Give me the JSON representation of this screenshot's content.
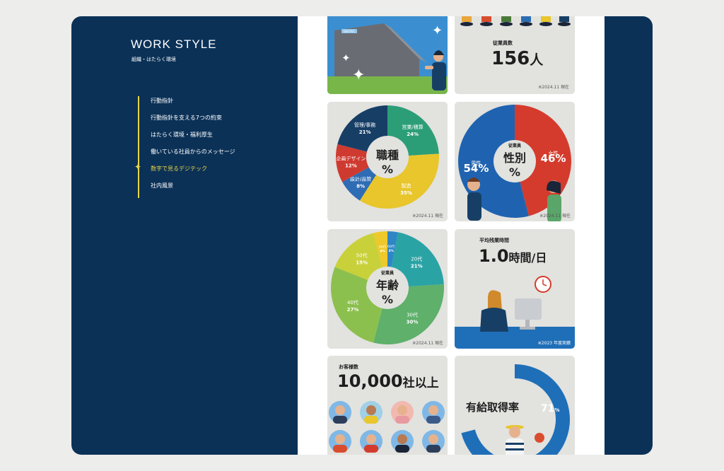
{
  "sidebar": {
    "title": "WORK STYLE",
    "subtitle": "組織・はたらく環境",
    "items": [
      {
        "label": "行動指針",
        "active": false
      },
      {
        "label": "行動指針を支える7つの約束",
        "active": false
      },
      {
        "label": "はたらく環境・福利厚生",
        "active": false
      },
      {
        "label": "働いている社員からのメッセージ",
        "active": false
      },
      {
        "label": "数字で見るデジテック",
        "active": true
      },
      {
        "label": "社内風景",
        "active": false
      }
    ]
  },
  "employees": {
    "label": "従業員数",
    "value": "156",
    "unit": "人",
    "note": "※2024.11 現在"
  },
  "building": {
    "sign": "DIGITEC"
  },
  "job_chart": {
    "center_line1": "職種",
    "center_line2": "%",
    "note": "※2024.11 現在",
    "slices": [
      {
        "name": "営業/積算",
        "value": 24,
        "pct": "24%",
        "color": "#2c9e77"
      },
      {
        "name": "製造",
        "value": 35,
        "pct": "35%",
        "color": "#e8c62c"
      },
      {
        "name": "設計/品管",
        "value": 8,
        "pct": "8%",
        "color": "#2e6cb4"
      },
      {
        "name": "企画デザイン",
        "value": 12,
        "pct": "12%",
        "color": "#cf3a30"
      },
      {
        "name": "管理/事務",
        "value": 21,
        "pct": "21%",
        "color": "#173f66"
      }
    ]
  },
  "gender_chart": {
    "center_small": "従業員",
    "center_line1": "性別",
    "center_line2": "%",
    "note": "※2024.11 現在",
    "slices": [
      {
        "name": "女性",
        "value": 46,
        "pct": "46%",
        "color": "#d43b2c"
      },
      {
        "name": "男性",
        "value": 54,
        "pct": "54%",
        "color": "#1f63b0"
      }
    ]
  },
  "age_chart": {
    "center_small": "従業員",
    "center_line1": "年齢",
    "center_line2": "%",
    "note": "※2024.11 現在",
    "slices": [
      {
        "name": "60代",
        "value": 3,
        "pct": "3%",
        "color": "#2f86c5"
      },
      {
        "name": "20代",
        "value": 21,
        "pct": "21%",
        "color": "#2aa3a5"
      },
      {
        "name": "30代",
        "value": 30,
        "pct": "30%",
        "color": "#5eb06a"
      },
      {
        "name": "40代",
        "value": 27,
        "pct": "27%",
        "color": "#8cc04e"
      },
      {
        "name": "50代",
        "value": 15,
        "pct": "15%",
        "color": "#c8d13a"
      },
      {
        "name": "60代",
        "value": 4,
        "pct": "4%",
        "color": "#eec92b"
      }
    ]
  },
  "overtime": {
    "label": "平均残業時間",
    "value": "1.0",
    "unit": "時間/日",
    "note": "※2023 年度実績"
  },
  "clients": {
    "label": "お客様数",
    "value": "10,000",
    "unit": "社以上"
  },
  "leave": {
    "label": "有給取得率",
    "value": "71",
    "unit": "%",
    "rate": 71
  },
  "chart_data": [
    {
      "type": "pie",
      "title": "職種",
      "categories": [
        "営業/積算",
        "製造",
        "設計/品管",
        "企画デザイン",
        "管理/事務"
      ],
      "values": [
        24,
        35,
        8,
        12,
        21
      ]
    },
    {
      "type": "pie",
      "title": "性別",
      "categories": [
        "女性",
        "男性"
      ],
      "values": [
        46,
        54
      ]
    },
    {
      "type": "pie",
      "title": "年齢",
      "categories": [
        "60代",
        "20代",
        "30代",
        "40代",
        "50代",
        "60代"
      ],
      "values": [
        3,
        21,
        30,
        27,
        15,
        4
      ]
    }
  ]
}
